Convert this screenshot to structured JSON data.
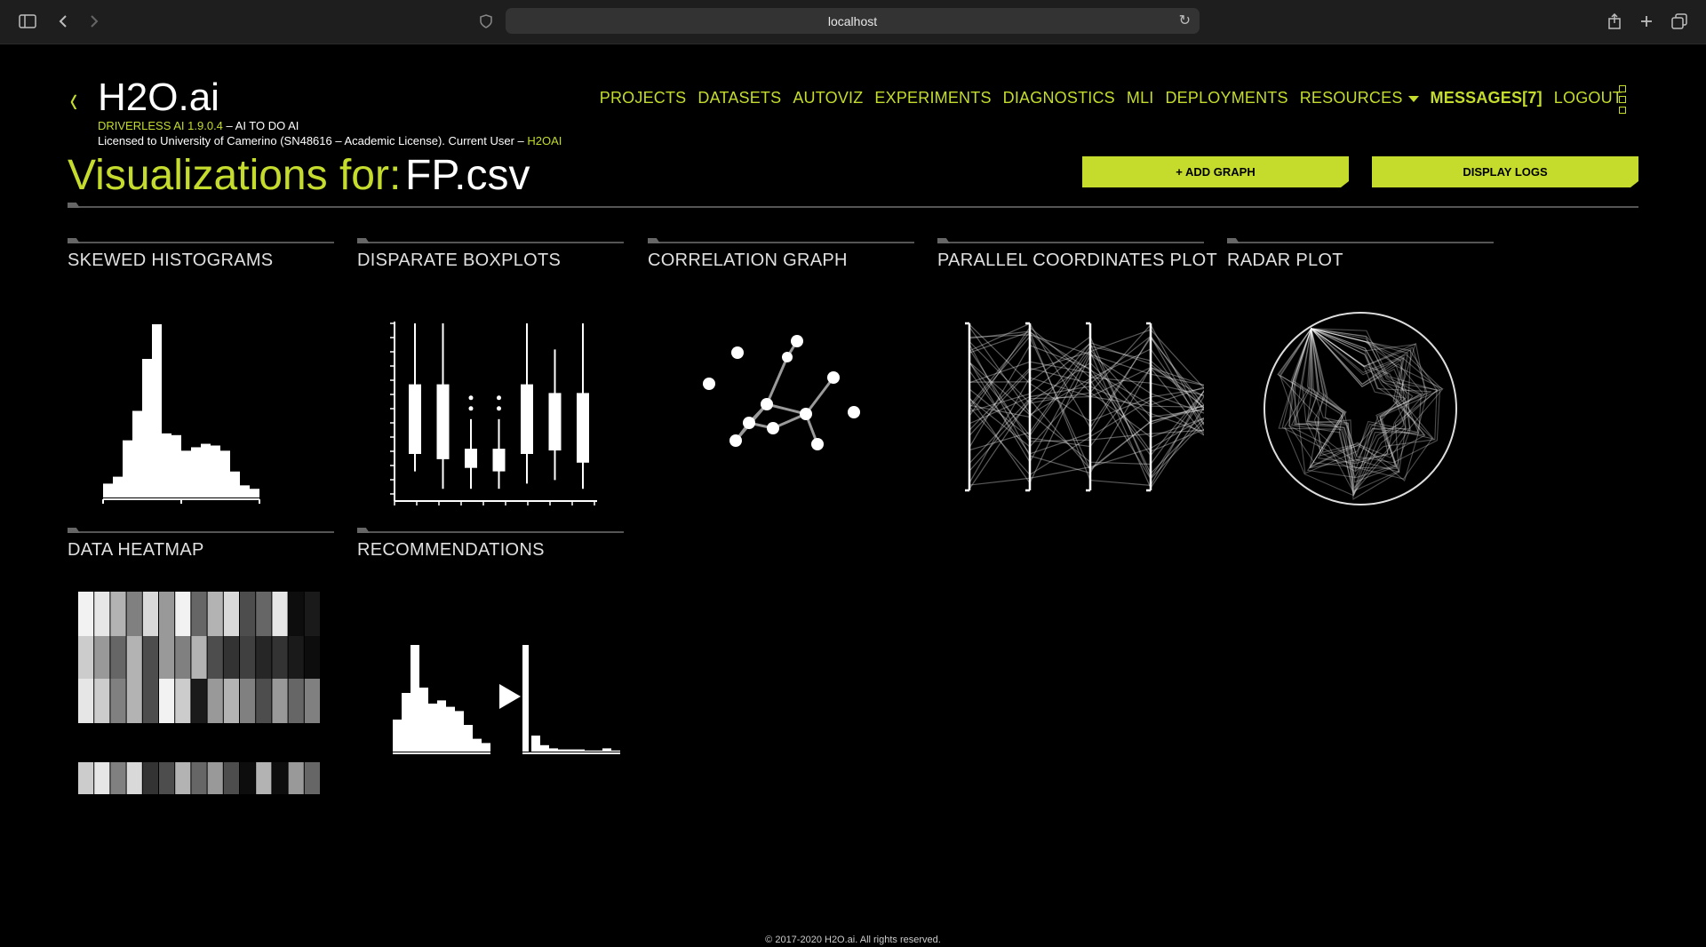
{
  "browser": {
    "url": "localhost",
    "icons": [
      "sidebar-icon",
      "back-icon",
      "forward-icon",
      "shield-icon",
      "reload-icon",
      "share-icon",
      "new-tab-icon",
      "tabs-icon"
    ]
  },
  "brand": {
    "name": "H2O.ai",
    "version": "DRIVERLESS AI 1.9.0.4",
    "tagline": " – AI TO DO AI",
    "license": "Licensed to University of Camerino (SN48616 – Academic License). Current User – ",
    "user": "H2OAI"
  },
  "nav": {
    "items": [
      "PROJECTS",
      "DATASETS",
      "AUTOVIZ",
      "EXPERIMENTS",
      "DIAGNOSTICS",
      "MLI",
      "DEPLOYMENTS"
    ],
    "resources": "RESOURCES",
    "messages": "MESSAGES[7]",
    "logout": "LOGOUT"
  },
  "page": {
    "title": "Visualizations for:",
    "file": "FP.csv"
  },
  "buttons": {
    "add_graph": "+ ADD GRAPH",
    "display_logs": "DISPLAY LOGS"
  },
  "cards": [
    {
      "title": "SKEWED HISTOGRAMS"
    },
    {
      "title": "DISPARATE BOXPLOTS"
    },
    {
      "title": "CORRELATION GRAPH"
    },
    {
      "title": "PARALLEL COORDINATES PLOT"
    },
    {
      "title": "RADAR PLOT"
    },
    {
      "title": "DATA HEATMAP"
    },
    {
      "title": "RECOMMENDATIONS"
    }
  ],
  "thumbnails": {
    "histogram_bars": [
      0.08,
      0.12,
      0.33,
      0.5,
      0.8,
      1.0,
      0.37,
      0.36,
      0.27,
      0.29,
      0.31,
      0.3,
      0.27,
      0.15,
      0.07,
      0.05
    ],
    "boxplots": [
      {
        "lo": 0.15,
        "q1": 0.25,
        "q3": 0.65,
        "hi": 1.0
      },
      {
        "lo": 0.05,
        "q1": 0.22,
        "q3": 0.65,
        "hi": 1.0
      },
      {
        "lo": 0.05,
        "q1": 0.17,
        "q3": 0.28,
        "hi": 0.45
      },
      {
        "lo": 0.05,
        "q1": 0.15,
        "q3": 0.28,
        "hi": 0.45
      },
      {
        "lo": 0.08,
        "q1": 0.25,
        "q3": 0.65,
        "hi": 1.0
      },
      {
        "lo": 0.1,
        "q1": 0.27,
        "q3": 0.6,
        "hi": 0.85
      },
      {
        "lo": 0.05,
        "q1": 0.2,
        "q3": 0.6,
        "hi": 1.0
      }
    ],
    "heatmap_rows": [
      [
        0.95,
        0.9,
        0.7,
        0.5,
        0.85,
        0.6,
        0.95,
        0.4,
        0.7,
        0.85,
        0.3,
        0.4,
        0.9,
        0.05,
        0.1
      ],
      [
        0.8,
        0.6,
        0.4,
        0.7,
        0.3,
        0.6,
        0.5,
        0.7,
        0.3,
        0.2,
        0.25,
        0.15,
        0.2,
        0.1,
        0.05
      ],
      [
        0.9,
        0.8,
        0.5,
        0.7,
        0.3,
        0.95,
        0.8,
        0.1,
        0.6,
        0.7,
        0.5,
        0.3,
        0.6,
        0.4,
        0.5
      ],
      [
        0.8,
        0.9,
        0.5,
        0.85,
        0.2,
        0.3,
        0.7,
        0.4,
        0.6,
        0.3,
        0.05,
        0.7,
        0.05,
        0.6,
        0.4
      ]
    ]
  },
  "footer": "© 2017-2020 H2O.ai. All rights reserved.",
  "colors": {
    "accent": "#c5dc2d",
    "background": "#000000",
    "browser_bar": "#1e1e1e"
  }
}
